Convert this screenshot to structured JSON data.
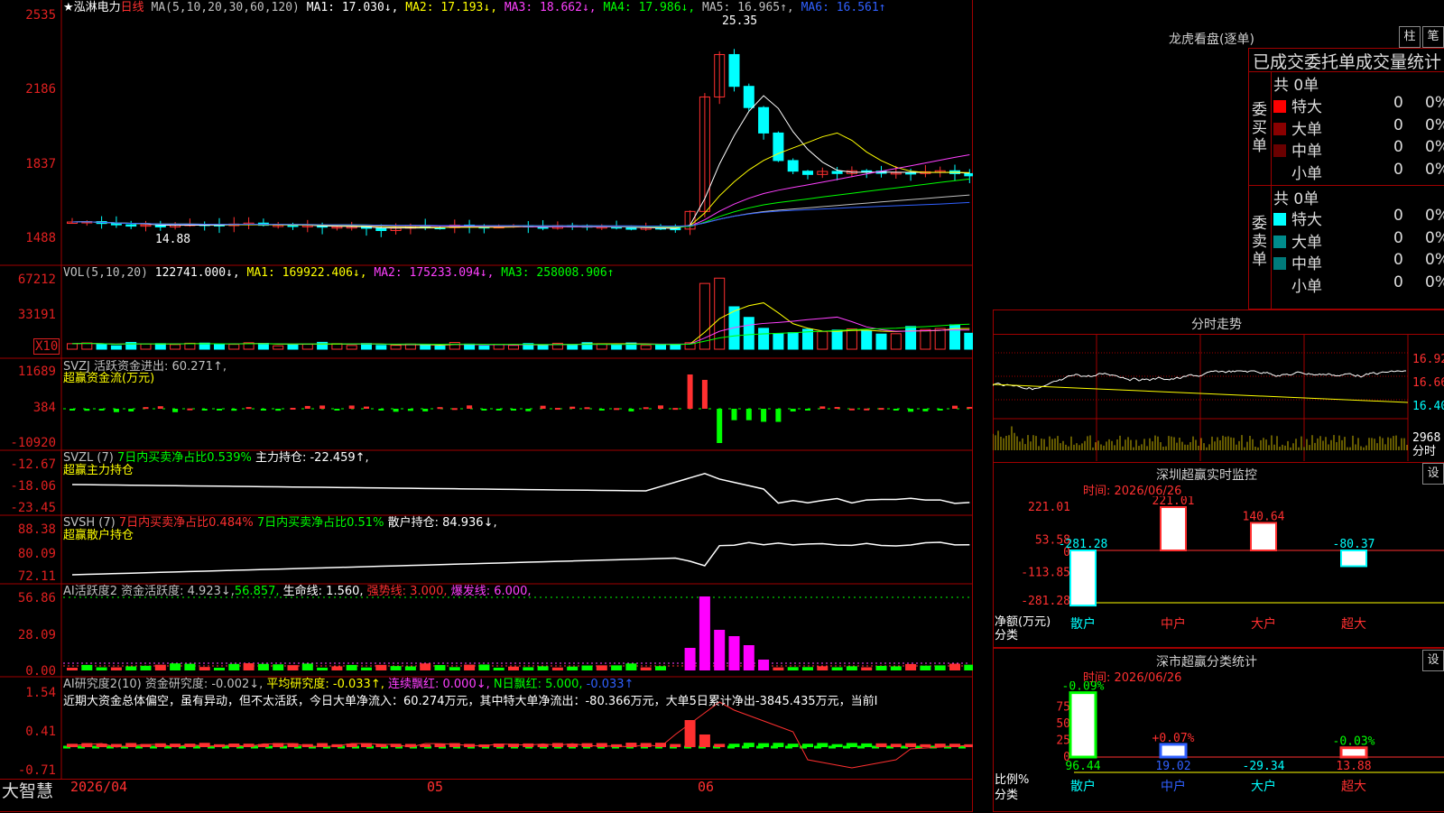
{
  "colors": {
    "up": "#ff3030",
    "down": "#00ffff",
    "frame": "#a00000",
    "ma1": "#ffffff",
    "ma2": "#ffff00",
    "ma3": "#ff40ff",
    "ma4": "#00ff00",
    "ma5": "#c0c0c0",
    "ma6": "#3060ff"
  },
  "top_axis_label": "2535",
  "main_chart": {
    "stock": "★泓淋电力",
    "period": "日线",
    "ma_params": "MA(5,10,20,30,60,120)",
    "ma1": "MA1: 17.030↓,",
    "ma2": "MA2: 17.193↓,",
    "ma3": "MA3: 18.662↓,",
    "ma4": "MA4: 17.986↓,",
    "ma5": "MA5: 16.965↑,",
    "ma6": "MA6: 16.561↑",
    "high_label": "25.35",
    "low_label": "14.88",
    "y_ticks": [
      "2535",
      "2186",
      "1837",
      "1488"
    ]
  },
  "vol_chart": {
    "label": "VOL(5,10,20)",
    "value": "122741.000↓,",
    "ma1": "MA1: 169922.406↓,",
    "ma2": "MA2: 175233.094↓,",
    "ma3": "MA3: 258008.906↑",
    "y_ticks": [
      "67212",
      "33191"
    ],
    "unit": "X10"
  },
  "svzj": {
    "label": "SVZJ  活跃资金进出: 60.271↑,",
    "sub": "超赢资金流(万元)",
    "y_ticks": [
      "11689",
      "384",
      "-10920"
    ]
  },
  "svzl": {
    "label1": "SVZL (7)",
    "label2": "7日内买卖净占比0.539%",
    "label3": "主力持仓: -22.459↑,",
    "sub": "超赢主力持仓",
    "y_ticks": [
      "-12.67",
      "-18.06",
      "-23.45"
    ]
  },
  "svsh": {
    "label1": "SVSH (7)",
    "label2": "7日内买卖净占比0.484%",
    "label3": "7日内买卖净占比0.51%",
    "label4": "散户持仓: 84.936↓,",
    "sub": "超赢散户持仓",
    "y_ticks": [
      "88.38",
      "80.09",
      "72.11"
    ]
  },
  "ai_active": {
    "label1": "AI活跃度2 资金活跃度: 4.923↓,",
    "label2": "56.857,",
    "label3": "生命线: 1.560,",
    "label4": "强势线: 3.000,",
    "label5": "爆发线: 6.000,",
    "y_ticks": [
      "56.86",
      "28.09",
      "0.00"
    ]
  },
  "ai_research": {
    "label1": "AI研究度2(10) 资金研究度: -0.002↓,",
    "label2": "平均研究度: -0.033↑,",
    "label3": "连续飘红: 0.000↓,",
    "label4": "N日飘红: 5.000,",
    "label5": "-0.033↑",
    "comment": "近期大资金总体偏空，虽有异动，但不太活跃，今日大单净流入：60.274万元，其中特大单净流出：-80.366万元，大单5日累计净出-3845.435万元，当前I",
    "y_ticks": [
      "1.54",
      "0.41",
      "-0.71"
    ]
  },
  "bottom": {
    "brand": "大智慧",
    "dates": [
      "2026/04",
      "05",
      "06"
    ]
  },
  "dragon_tiger": {
    "title": "龙虎看盘(逐单)",
    "btn1": "柱",
    "btn2": "笔",
    "header": "已成交委托单成交量统计",
    "buy_label": "委买单",
    "sell_label": "委卖单",
    "buy_total": "共 0单",
    "sell_total": "共 0单",
    "buy_rows": [
      {
        "name": "特大",
        "count": "0",
        "pct": "0%",
        "color": "#ff0000"
      },
      {
        "name": "大单",
        "count": "0",
        "pct": "0%",
        "color": "#8b0000"
      },
      {
        "name": "中单",
        "count": "0",
        "pct": "0%",
        "color": "#6a0000"
      },
      {
        "name": "小单",
        "count": "0",
        "pct": "0%",
        "color": "#000000"
      }
    ],
    "sell_rows": [
      {
        "name": "特大",
        "count": "0",
        "pct": "0%",
        "color": "#00ffff"
      },
      {
        "name": "大单",
        "count": "0",
        "pct": "0%",
        "color": "#008b8b"
      },
      {
        "name": "中单",
        "count": "0",
        "pct": "0%",
        "color": "#007a7a"
      },
      {
        "name": "小单",
        "count": "0",
        "pct": "0%",
        "color": "#000000"
      }
    ]
  },
  "intraday": {
    "title": "分时走势",
    "prices": [
      "16.92",
      "16.66",
      "16.40"
    ],
    "vol": "2968",
    "vol_label": "分时"
  },
  "sz_monitor": {
    "title": "深圳超赢实时监控",
    "btn": "设",
    "time": "时间: 2026/06/26",
    "y_ticks": [
      "221.01",
      "53.58",
      "0",
      "-113.85",
      "-281.28"
    ],
    "y_label1": "净额(万元)",
    "y_label2": "分类",
    "bars": [
      {
        "cat": "散户",
        "value": -281.28,
        "label": "-281.28"
      },
      {
        "cat": "中户",
        "value": 221.01,
        "label": "221.01"
      },
      {
        "cat": "大户",
        "value": 140.64,
        "label": "140.64"
      },
      {
        "cat": "超大",
        "value": -80.37,
        "label": "-80.37"
      }
    ]
  },
  "sz_class": {
    "title": "深市超赢分类统计",
    "btn": "设",
    "time": "时间: 2026/06/26",
    "y_ticks": [
      "75",
      "50",
      "25",
      "0"
    ],
    "y_label1": "比例%",
    "y_label2": "分类",
    "bars": [
      {
        "cat": "散户",
        "value": 96.44,
        "top": "-0.09%",
        "bottom": "96.44"
      },
      {
        "cat": "中户",
        "value": 19.02,
        "top": "+0.07%",
        "bottom": "19.02"
      },
      {
        "cat": "大户",
        "value": -29.34,
        "top": "",
        "bottom": "-29.34"
      },
      {
        "cat": "超大",
        "value": 13.88,
        "top": "-0.03%",
        "bottom": "13.88"
      }
    ]
  }
}
